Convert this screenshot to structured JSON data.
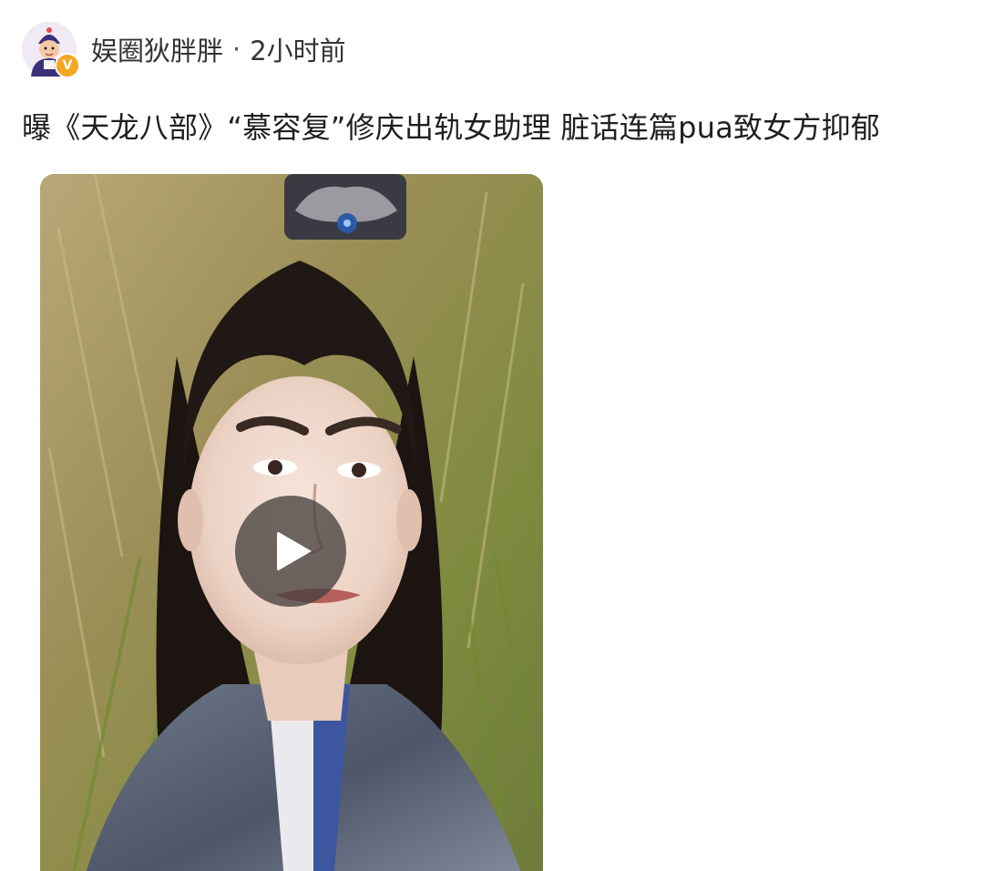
{
  "post": {
    "author_name": "娱圈狄胖胖",
    "separator": "·",
    "time": "2小时前",
    "verified_badge": "V",
    "title": "曝《天龙八部》“慕容复”修庆出轨女助理 脏话连篇pua致女方抑郁"
  },
  "icons": {
    "avatar": "cartoon-avatar-icon",
    "verified": "verified-badge-icon",
    "play": "play-icon"
  },
  "colors": {
    "badge": "#f5a623",
    "play_overlay": "#46403e"
  }
}
